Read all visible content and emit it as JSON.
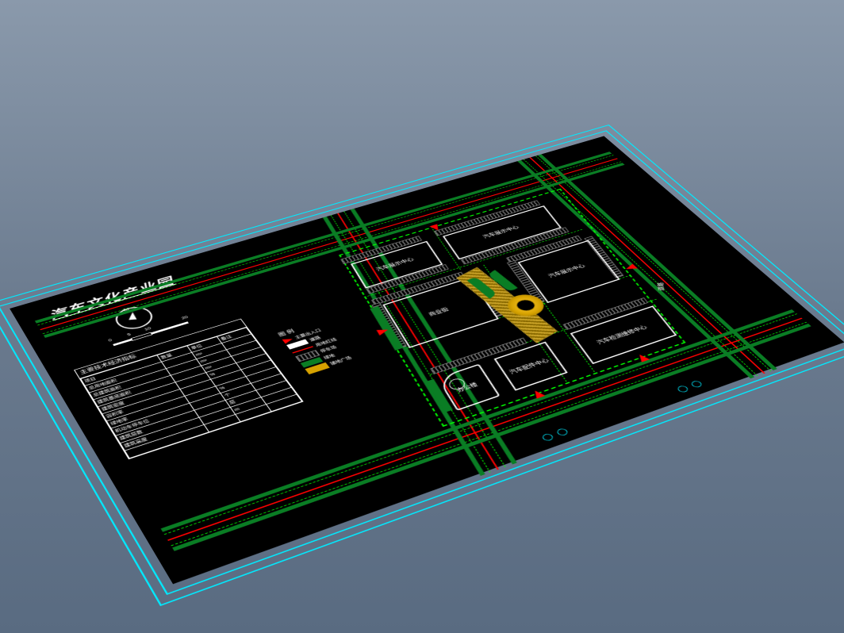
{
  "title": "汽车文化产业园",
  "compass_label": "N",
  "scale": {
    "ticks": [
      "0",
      "5",
      "10",
      "20"
    ]
  },
  "spec_table": {
    "header": "主要技术经济指标",
    "columns": [
      "项目",
      "数量",
      "单位",
      "备注"
    ],
    "rows": [
      [
        "总用地面积",
        "",
        "m²",
        ""
      ],
      [
        "总建筑面积",
        "",
        "m²",
        ""
      ],
      [
        "建筑基底面积",
        "",
        "m²",
        ""
      ],
      [
        "建筑密度",
        "",
        "%",
        ""
      ],
      [
        "容积率",
        "",
        "",
        ""
      ],
      [
        "绿地率",
        "",
        "%",
        ""
      ],
      [
        "机动车停车位",
        "",
        "个",
        ""
      ],
      [
        "建筑层数",
        "",
        "层",
        ""
      ],
      [
        "建筑高度",
        "",
        "m",
        ""
      ],
      [
        "",
        "",
        "",
        ""
      ]
    ]
  },
  "legend": {
    "title": "图 例",
    "items": [
      {
        "key": "entrance",
        "label": "主要出入口"
      },
      {
        "key": "road",
        "label": "道路"
      },
      {
        "key": "boundary",
        "label": "用地红线"
      },
      {
        "key": "parking",
        "label": "停车场"
      },
      {
        "key": "green",
        "label": "绿地"
      },
      {
        "key": "plaza",
        "label": "铺地广场"
      }
    ]
  },
  "buildings": {
    "b1": "汽车展示中心",
    "b2": "汽车展示中心",
    "b3": "商业街",
    "b4": "汽车展示中心",
    "b5": "汽车配件中心",
    "b6": "汽车检测维修中心",
    "b7": "办公楼"
  },
  "road_label": "道路"
}
